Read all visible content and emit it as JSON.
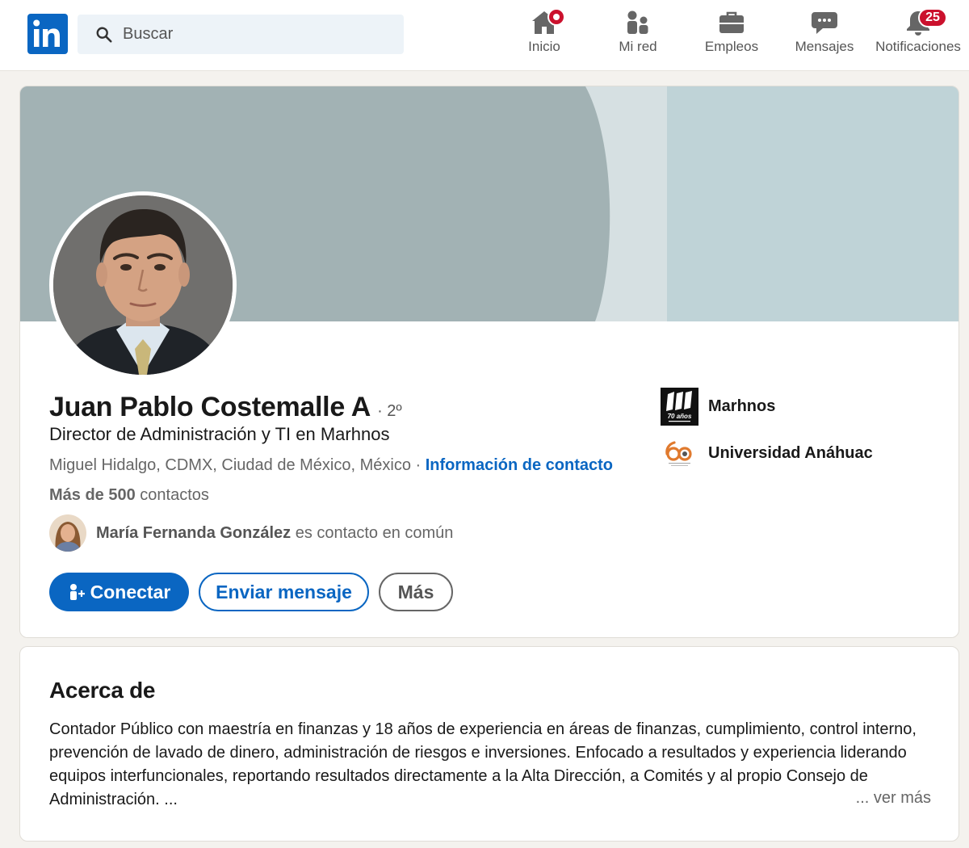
{
  "nav": {
    "search_placeholder": "Buscar",
    "items": [
      {
        "label": "Inicio",
        "icon": "home-icon"
      },
      {
        "label": "Mi red",
        "icon": "network-icon"
      },
      {
        "label": "Empleos",
        "icon": "briefcase-icon"
      },
      {
        "label": "Mensajes",
        "icon": "messages-icon"
      },
      {
        "label": "Notificaciones",
        "icon": "bell-icon",
        "badge": "25"
      }
    ]
  },
  "profile": {
    "name": "Juan Pablo Costemalle A",
    "degree": "· 2º",
    "headline": "Director de Administración y TI en Marhnos",
    "location": "Miguel Hidalgo, CDMX, Ciudad de México, México",
    "separator": " · ",
    "contact_link": "Información de contacto",
    "connections_bold": "Más de 500",
    "connections_rest": " contactos",
    "mutual_name": "María Fernanda González",
    "mutual_rest": " es contacto en común",
    "buttons": {
      "connect": "Conectar",
      "message": "Enviar mensaje",
      "more": "Más"
    },
    "orgs": [
      {
        "name": "Marhnos",
        "logo_text": "70 años"
      },
      {
        "name": "Universidad Anáhuac"
      }
    ]
  },
  "about": {
    "title": "Acerca de",
    "text": "Contador Público con maestría en finanzas y 18 años de experiencia en áreas de finanzas, cumplimiento, control interno, prevención de lavado de dinero, administración de riesgos e inversiones. Enfocado a resultados y experiencia liderando equipos interfuncionales, reportando resultados directamente a la Alta Dirección, a Comités y al propio Consejo de Administración. ...",
    "see_more": "... ver más"
  },
  "colors": {
    "brand": "#0a66c2",
    "badge": "#cb112d",
    "banner_dark": "#a2b2b4",
    "banner_light": "#d6e0e2",
    "banner_right": "#bfd3d7"
  }
}
